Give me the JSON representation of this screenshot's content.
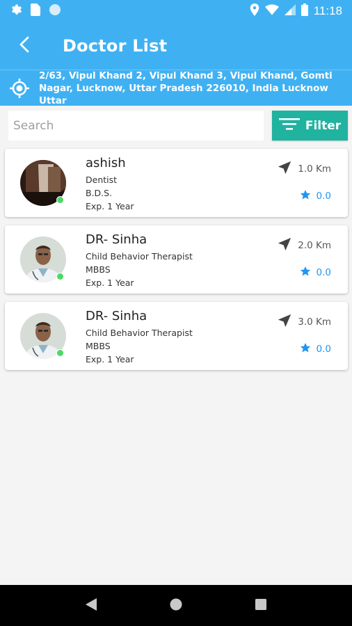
{
  "status_bar": {
    "time": "11:18",
    "icons": [
      "settings-icon",
      "sim-card-icon",
      "circle-icon",
      "location-icon",
      "wifi-icon",
      "signal-icon",
      "battery-icon"
    ]
  },
  "app_bar": {
    "title": "Doctor List",
    "back_icon": "back-arrow-icon"
  },
  "location": {
    "icon": "my-location-icon",
    "address": "2/63, Vipul Khand 2, Vipul Khand 3, Vipul Khand, Gomti Nagar, Lucknow, Uttar Pradesh 226010, India Lucknow Uttar"
  },
  "search": {
    "placeholder": "Search",
    "value": ""
  },
  "filter": {
    "label": "Filter",
    "icon": "filter-lines-icon"
  },
  "doctors": [
    {
      "name": "ashish",
      "specialty": "Dentist",
      "degree": "B.D.S.",
      "experience": "Exp. 1 Year",
      "distance": "1.0 Km",
      "rating": "0.0",
      "online": true
    },
    {
      "name": "DR- Sinha",
      "specialty": "Child Behavior Therapist",
      "degree": "MBBS",
      "experience": "Exp. 1 Year",
      "distance": "2.0 Km",
      "rating": "0.0",
      "online": true
    },
    {
      "name": "DR- Sinha",
      "specialty": "Child Behavior Therapist",
      "degree": "MBBS",
      "experience": "Exp. 1 Year",
      "distance": "3.0 Km",
      "rating": "0.0",
      "online": true
    }
  ],
  "nav": {
    "icons": [
      "back-triangle-icon",
      "home-circle-icon",
      "recents-square-icon"
    ]
  },
  "colors": {
    "primary": "#3fb1f3",
    "filter": "#1fb3a0",
    "online": "#4cd964",
    "rating": "#2196f3"
  }
}
